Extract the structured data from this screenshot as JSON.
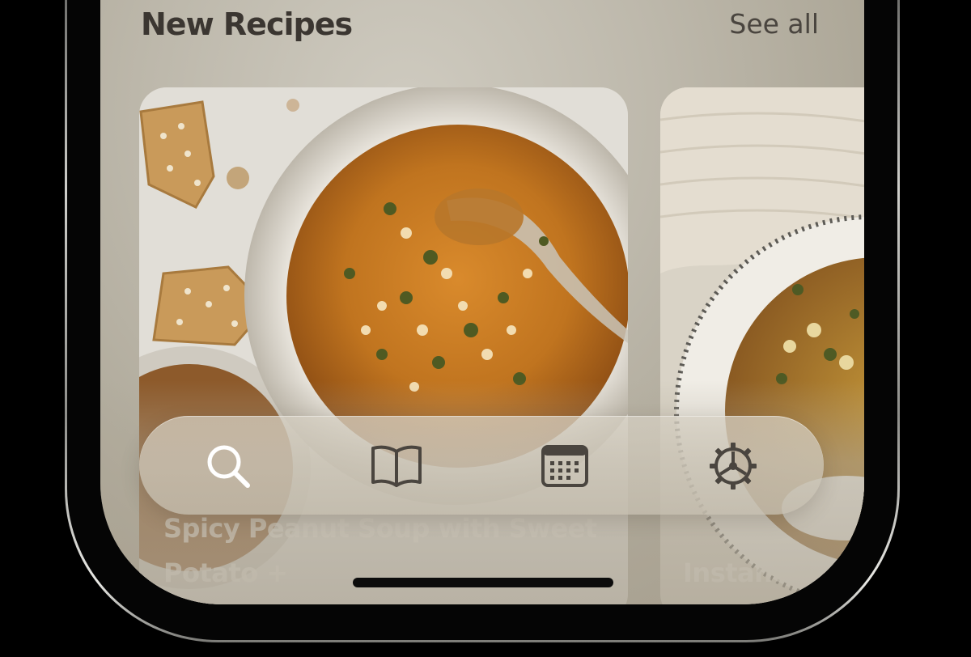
{
  "section": {
    "title": "New Recipes",
    "see_all_label": "See all"
  },
  "cards": [
    {
      "title": "Spicy Peanut Soup with Sweet Potato +"
    },
    {
      "title": "Instant Po"
    }
  ],
  "tab_bar": {
    "tabs": [
      {
        "icon": "search-icon",
        "active": true
      },
      {
        "icon": "book-icon",
        "active": false
      },
      {
        "icon": "calendar-icon",
        "active": false
      },
      {
        "icon": "gear-icon",
        "active": false
      }
    ]
  },
  "colors": {
    "active_icon": "#ffffff",
    "inactive_icon": "#4a453f",
    "title_text": "#3b3631"
  }
}
